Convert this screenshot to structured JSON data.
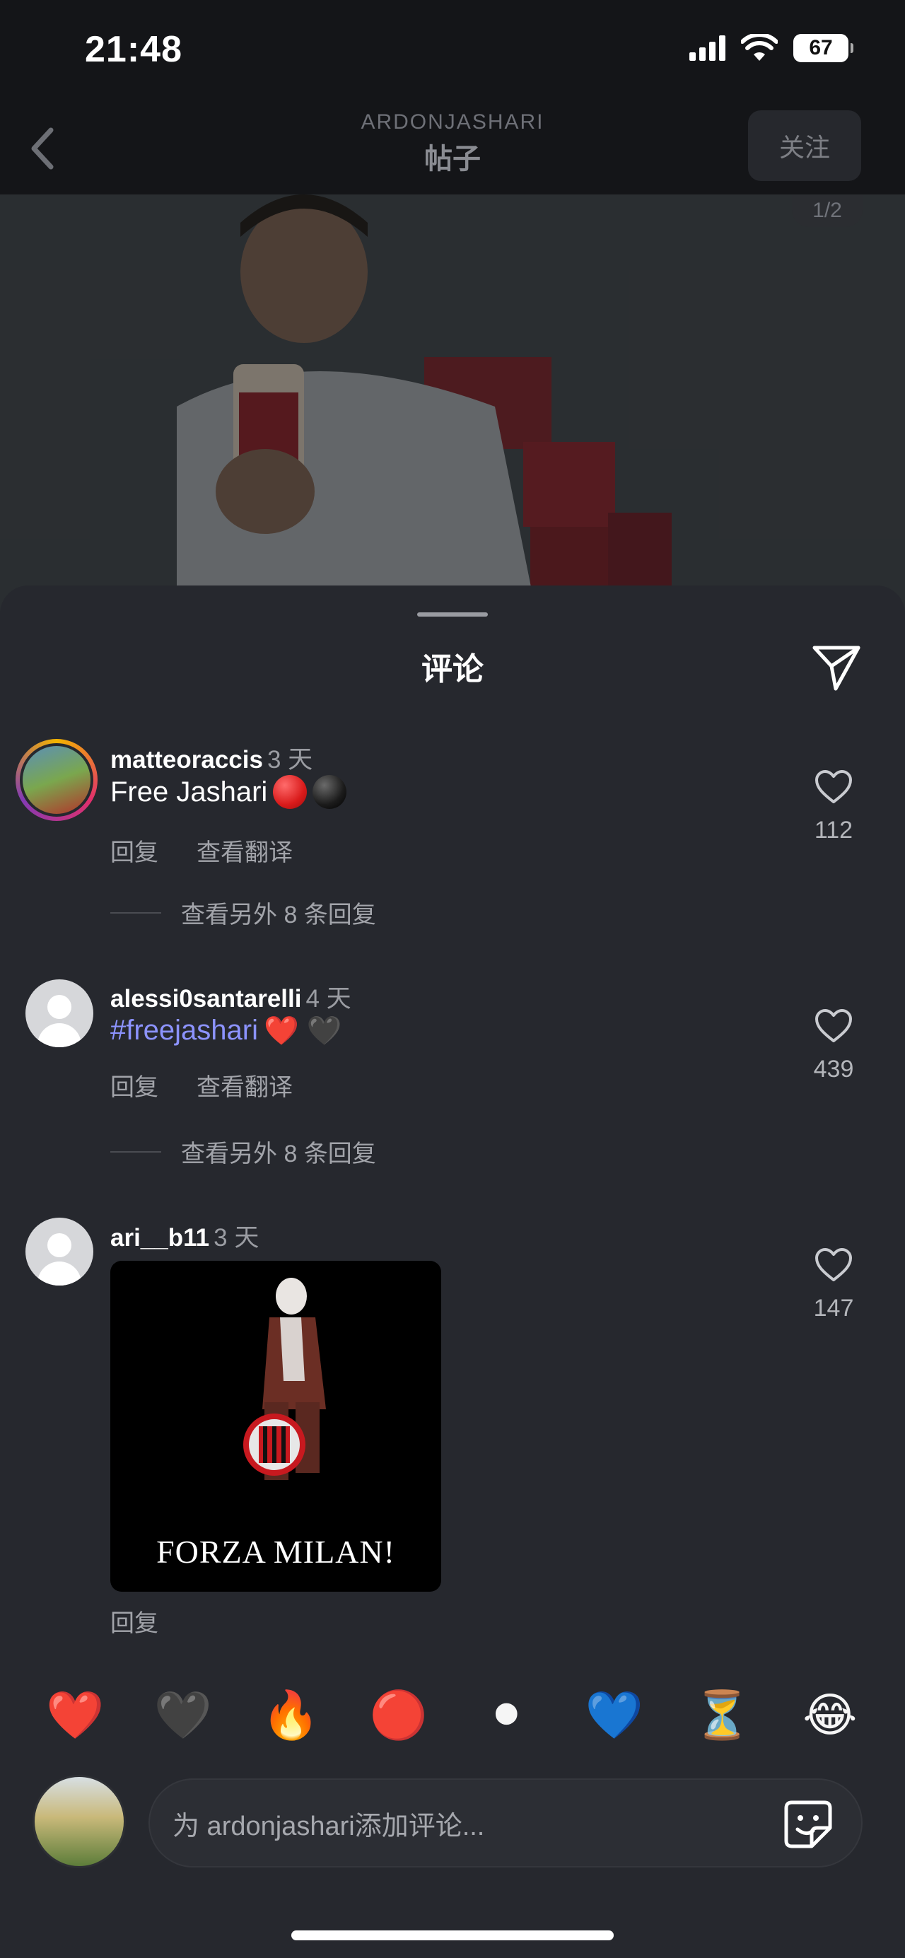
{
  "status_bar": {
    "time": "21:48",
    "battery": "67"
  },
  "header": {
    "username": "ARDONJASHARI",
    "subtitle": "帖子",
    "follow_label": "关注"
  },
  "post": {
    "page_counter": "1/2"
  },
  "sheet": {
    "title": "评论"
  },
  "comments": [
    {
      "username": "matteoraccis",
      "time": "3 天",
      "text": "Free Jashari",
      "emojis": [
        "red-circle",
        "black-circle"
      ],
      "reply_label": "回复",
      "translate_label": "查看翻译",
      "view_more": "查看另外 8 条回复",
      "likes": "112"
    },
    {
      "username": "alessi0santarelli",
      "time": "4 天",
      "hashtag": "#freejashari",
      "emoji_text": "❤️ 🖤",
      "reply_label": "回复",
      "translate_label": "查看翻译",
      "view_more": "查看另外 8 条回复",
      "likes": "439"
    },
    {
      "username": "ari__b11",
      "time": "3 天",
      "gif_caption": "FORZA MILAN!",
      "reply_label": "回复",
      "likes": "147"
    }
  ],
  "emoji_bar": [
    "❤️",
    "🖤",
    "🔥",
    "🔴",
    "⚫",
    "💙",
    "⏳",
    "😂"
  ],
  "composer": {
    "placeholder": "为 ardonjashari添加评论..."
  },
  "colors": {
    "background": "#1c1d21",
    "sheet": "#26282e",
    "hashtag": "#8c93ff"
  }
}
